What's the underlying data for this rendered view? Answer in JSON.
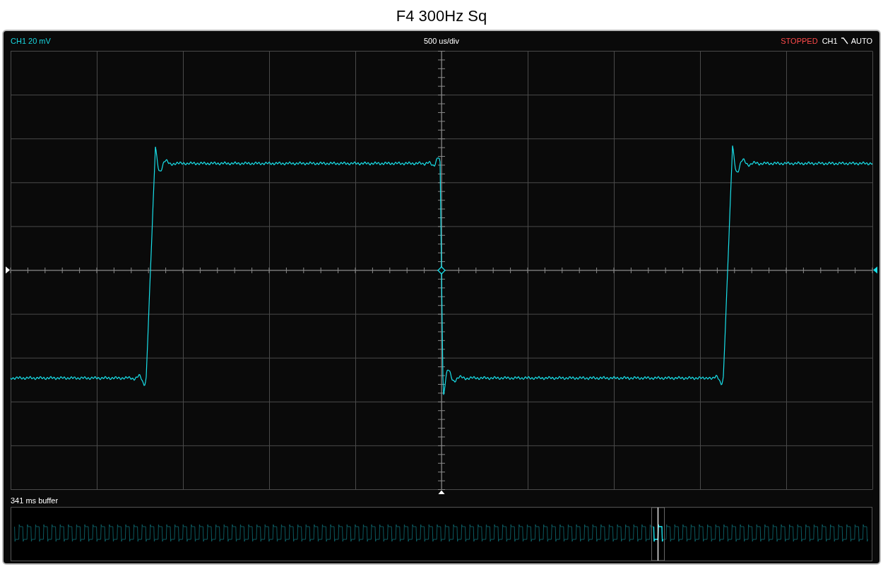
{
  "window": {
    "title": "F4 300Hz Sq"
  },
  "header": {
    "channel_scale": "CH1 20 mV",
    "timebase": "500 us/div",
    "status": "STOPPED",
    "running": false,
    "trigger_channel": "CH1",
    "trigger_falling": true,
    "trigger_mode": "AUTO"
  },
  "buffer": {
    "label": "341 ms buffer"
  }
}
